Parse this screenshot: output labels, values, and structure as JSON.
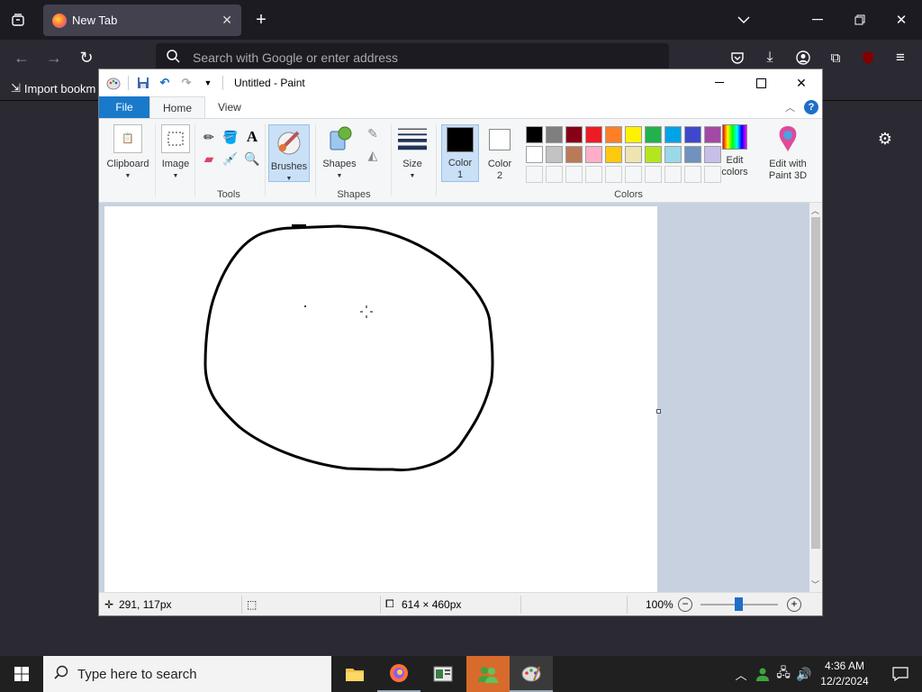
{
  "browser": {
    "tab_title": "New Tab",
    "url_placeholder": "Search with Google or enter address",
    "bookmark_import": "Import bookm"
  },
  "paint": {
    "window_title": "Untitled - Paint",
    "menu": {
      "file": "File",
      "home": "Home",
      "view": "View"
    },
    "groups": {
      "clipboard": "Clipboard",
      "image": "Image",
      "tools": "Tools",
      "brushes": "Brushes",
      "shapes": "Shapes",
      "shapes_group": "Shapes",
      "size": "Size",
      "colors": "Colors"
    },
    "color1_label": "Color",
    "color1_num": "1",
    "color2_label": "Color",
    "color2_num": "2",
    "edit_colors_1": "Edit",
    "edit_colors_2": "colors",
    "paint3d_1": "Edit with",
    "paint3d_2": "Paint 3D",
    "palette_row1": [
      "#000000",
      "#7f7f7f",
      "#880015",
      "#ed1c24",
      "#ff7f27",
      "#fff200",
      "#22b14c",
      "#00a2e8",
      "#3f48cc",
      "#a349a4"
    ],
    "palette_row2": [
      "#ffffff",
      "#c3c3c3",
      "#b97a57",
      "#ffaec9",
      "#ffc90e",
      "#efe4b0",
      "#b5e61d",
      "#99d9ea",
      "#7092be",
      "#c8bfe7"
    ],
    "status": {
      "cursor_pos": "291, 117px",
      "canvas_size": "614 × 460px",
      "zoom": "100%"
    }
  },
  "taskbar": {
    "search_placeholder": "Type here to search",
    "time": "4:36 AM",
    "date": "12/2/2024"
  }
}
